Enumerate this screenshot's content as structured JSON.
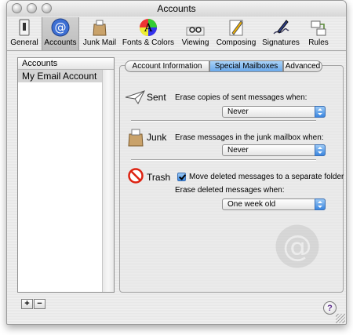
{
  "window": {
    "title": "Accounts"
  },
  "toolbar": {
    "items": [
      {
        "label": "General",
        "icon": "light-switch-icon"
      },
      {
        "label": "Accounts",
        "icon": "at-sign-icon",
        "selected": true
      },
      {
        "label": "Junk Mail",
        "icon": "junk-mail-bag-icon"
      },
      {
        "label": "Fonts & Colors",
        "icon": "font-colors-icon"
      },
      {
        "label": "Viewing",
        "icon": "glasses-icon"
      },
      {
        "label": "Composing",
        "icon": "pencil-note-icon"
      },
      {
        "label": "Signatures",
        "icon": "signature-pen-icon"
      },
      {
        "label": "Rules",
        "icon": "rules-envelope-icon"
      }
    ]
  },
  "accounts": {
    "header": "Accounts",
    "items": [
      "My Email Account"
    ],
    "add_label": "+",
    "remove_label": "−"
  },
  "tabs": [
    {
      "label": "Account Information"
    },
    {
      "label": "Special Mailboxes",
      "active": true
    },
    {
      "label": "Advanced"
    }
  ],
  "sent": {
    "label": "Sent",
    "text": "Erase copies of sent messages when:",
    "value": "Never"
  },
  "junk": {
    "label": "Junk",
    "text": "Erase messages in the junk mailbox when:",
    "value": "Never"
  },
  "trash": {
    "label": "Trash",
    "checkbox_label": "Move deleted messages to a separate folder",
    "checked": true,
    "text": "Erase deleted messages when:",
    "value": "One week old"
  },
  "help": {
    "label": "?"
  }
}
